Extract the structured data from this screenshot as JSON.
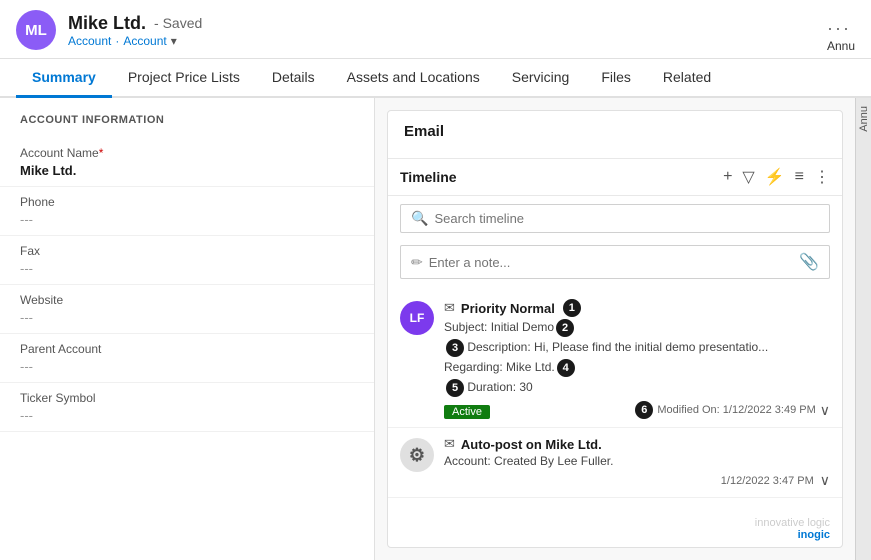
{
  "header": {
    "avatar": "ML",
    "name": "Mike Ltd.",
    "saved_label": "- Saved",
    "subtitle1": "Account",
    "subtitle2": "Account",
    "right_label": "Annu",
    "three_dots": "···"
  },
  "tabs": [
    {
      "id": "summary",
      "label": "Summary",
      "active": true
    },
    {
      "id": "project-price-lists",
      "label": "Project Price Lists",
      "active": false
    },
    {
      "id": "details",
      "label": "Details",
      "active": false
    },
    {
      "id": "assets-locations",
      "label": "Assets and Locations",
      "active": false
    },
    {
      "id": "servicing",
      "label": "Servicing",
      "active": false
    },
    {
      "id": "files",
      "label": "Files",
      "active": false
    },
    {
      "id": "related",
      "label": "Related",
      "active": false
    }
  ],
  "left_panel": {
    "section_title": "ACCOUNT INFORMATION",
    "fields": [
      {
        "label": "Account Name",
        "required": true,
        "value": "Mike Ltd.",
        "empty": false
      },
      {
        "label": "Phone",
        "required": false,
        "value": "---",
        "empty": true
      },
      {
        "label": "Fax",
        "required": false,
        "value": "---",
        "empty": true
      },
      {
        "label": "Website",
        "required": false,
        "value": "---",
        "empty": true
      },
      {
        "label": "Parent Account",
        "required": false,
        "value": "---",
        "empty": true
      },
      {
        "label": "Ticker Symbol",
        "required": false,
        "value": "---",
        "empty": true
      }
    ]
  },
  "email_section": {
    "title": "Email",
    "timeline_label": "Timeline",
    "timeline_icons": [
      "+",
      "▽",
      "⚡",
      "≡",
      "⋮"
    ],
    "search_placeholder": "Search timeline",
    "note_placeholder": "Enter a note...",
    "entries": [
      {
        "avatar": "LF",
        "avatar_color": "#7c3aed",
        "type_icon": "✉",
        "title": "Priority Normal",
        "num": 1,
        "lines": [
          {
            "text": "Subject: Initial Demo",
            "num": 2
          },
          {
            "text": "Description: Hi, Please find the initial demo presentatio...",
            "num": 3,
            "num_before": true
          },
          {
            "text": "Regarding: Mike Ltd.",
            "num": 4
          }
        ],
        "duration": "Duration: 30",
        "num5": 5,
        "badge": "Active",
        "modified": "Modified On: 1/12/2022 3:49 PM",
        "num6": 6
      },
      {
        "avatar": "⚙",
        "avatar_color": "#e8e8e8",
        "avatar_text_color": "#555",
        "type_icon": "✉",
        "title": "Auto-post on Mike Ltd.",
        "lines": [
          {
            "text": "Account: Created By Lee Fuller."
          }
        ],
        "modified": "1/12/2022 3:47 PM"
      }
    ]
  },
  "watermark": {
    "text": "innovative logic",
    "brand": "inogic"
  }
}
